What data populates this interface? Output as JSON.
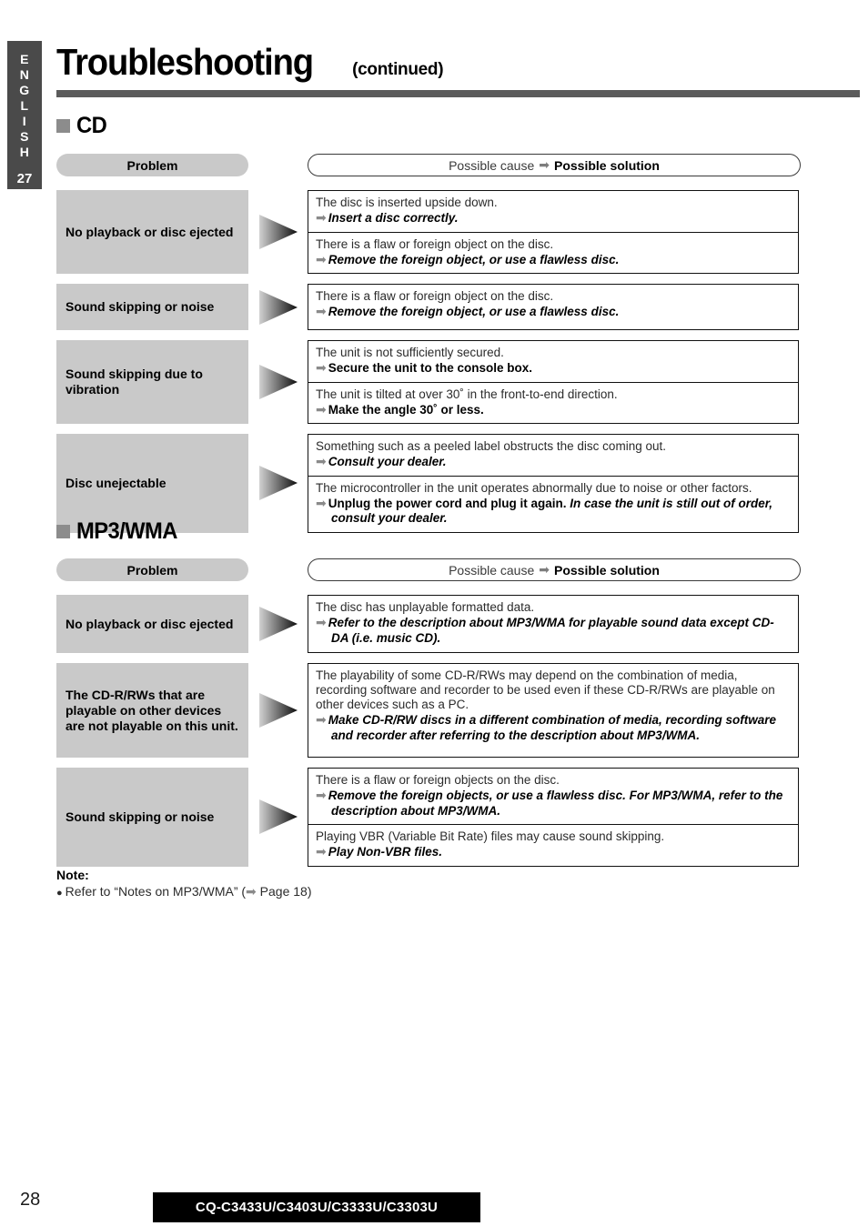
{
  "sidebar": {
    "language_letters": [
      "E",
      "N",
      "G",
      "L",
      "I",
      "S",
      "H"
    ],
    "page_marker": "27"
  },
  "header": {
    "title": "Troubleshooting",
    "subtitle": "(continued)"
  },
  "columns": {
    "problem_label": "Problem",
    "cause_label": "Possible cause",
    "arrow": "➡",
    "solution_label": "Possible solution"
  },
  "sections": [
    {
      "heading": "CD",
      "rows": [
        {
          "problem": "No playback or disc ejected",
          "boxes": [
            {
              "cause": "The disc is inserted upside down.",
              "solution_italic": "Insert a disc correctly.",
              "solution_upright": ""
            },
            {
              "cause": "There is a flaw or foreign object on the disc.",
              "solution_italic": "Remove the foreign object, or use a flawless disc.",
              "solution_upright": ""
            }
          ]
        },
        {
          "problem": "Sound skipping or noise",
          "boxes": [
            {
              "cause": "There is a flaw or foreign object on the disc.",
              "solution_italic": "Remove the foreign object, or use a flawless disc.",
              "solution_upright": ""
            }
          ]
        },
        {
          "problem": "Sound skipping due to vibration",
          "boxes": [
            {
              "cause": "The unit is not sufficiently secured.",
              "solution_italic": "",
              "solution_upright": "Secure the unit to the console box."
            },
            {
              "cause": "The unit is tilted at over 30˚ in the front-to-end direction.",
              "solution_italic": "",
              "solution_upright": "Make the angle 30˚ or less."
            }
          ]
        },
        {
          "problem": "Disc unejectable",
          "boxes": [
            {
              "cause": "Something such as a peeled label obstructs the disc coming out.",
              "solution_italic": "Consult your dealer.",
              "solution_upright": ""
            },
            {
              "cause": "The microcontroller in the unit operates abnormally due to noise or other factors.",
              "solution_upright": "Unplug the power cord and plug it again.",
              "solution_italic": "In case the unit is still out of order, consult your dealer."
            }
          ]
        }
      ]
    },
    {
      "heading": "MP3/WMA",
      "rows": [
        {
          "problem": "No playback or disc ejected",
          "boxes": [
            {
              "cause": "The disc has unplayable formatted data.",
              "solution_italic": "Refer to the description about MP3/WMA for playable sound data except CD-DA (i.e. music CD).",
              "solution_upright": ""
            }
          ]
        },
        {
          "problem": "The CD-R/RWs that are playable on other devices are not playable on this unit.",
          "boxes": [
            {
              "cause": "The playability of some CD-R/RWs may depend on the combination of media, recording software and recorder to be used even if these CD-R/RWs are playable on other devices such as a PC.",
              "solution_italic": "Make CD-R/RW discs in a different combination of media, recording software and recorder after referring to the description about MP3/WMA.",
              "solution_upright": ""
            }
          ]
        },
        {
          "problem": "Sound skipping or noise",
          "boxes": [
            {
              "cause": "There is a flaw or foreign objects on the disc.",
              "solution_italic": "Remove the foreign objects, or use a flawless disc. For MP3/WMA, refer to the description about MP3/WMA.",
              "solution_upright": ""
            },
            {
              "cause": "Playing VBR (Variable Bit Rate) files may cause sound skipping.",
              "solution_italic": "Play Non-VBR files.",
              "solution_upright": ""
            }
          ]
        }
      ]
    }
  ],
  "note": {
    "title": "Note:",
    "bullet": "●",
    "text_before": "Refer to “Notes on MP3/WMA” (",
    "arrow": "➡",
    "page_ref": " Page 18)"
  },
  "footer": {
    "page_number": "28",
    "model_numbers": "CQ-C3433U/C3403U/C3333U/C3303U"
  },
  "colors": {
    "rule": "#5b5b5b",
    "tab": "#4a4a4a",
    "problem_fill": "#c9c9c9",
    "square": "#8c8c8c",
    "arrow_gray": "#8a8a8a"
  }
}
